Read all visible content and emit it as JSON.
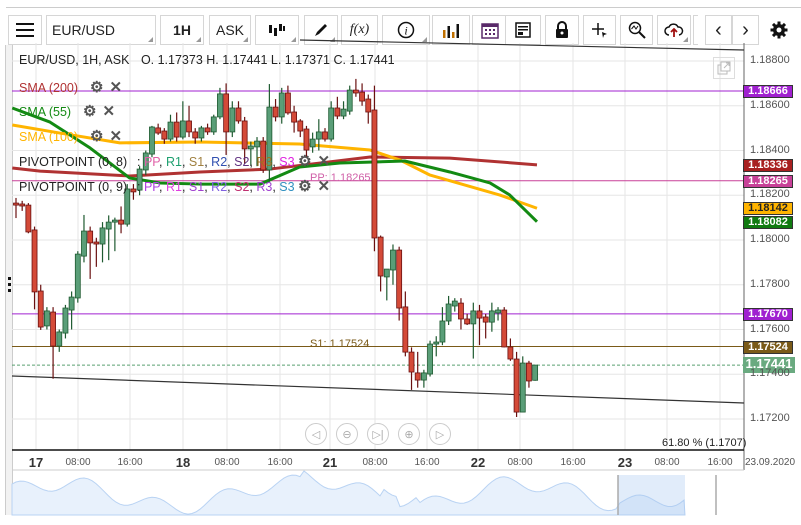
{
  "toolbar": {
    "symbol": "EUR/USD",
    "timeframe": "1H",
    "price_side": "ASK",
    "fx_label": "f(x)",
    "icons": [
      "menu-icon",
      "candlestick-type-icon",
      "pencil-icon",
      "function-icon",
      "info-icon",
      "bar-chart-icon",
      "calendar-icon",
      "news-icon",
      "lock-icon",
      "crosshair-icon",
      "zoom-icon",
      "cloud-upload-icon",
      "chevron-left-icon",
      "chevron-right-icon",
      "gear-icon"
    ]
  },
  "legend": {
    "instrument": "EUR/USD, 1H, ASK",
    "ohlc": "O. 1.17373 H. 1.17441 L. 1.17371 C. 1.17441",
    "indicators": [
      {
        "label": "SMA (200)",
        "color": "#b03232"
      },
      {
        "label": "SMA (55)",
        "color": "#138a13"
      },
      {
        "label": "SMA (100)",
        "color": "#ffb400"
      }
    ],
    "pivots": [
      {
        "label": "PIVOTPOINT (0, 8)",
        "sep": ":",
        "items": [
          {
            "t": "PP",
            "c": "#e060a8"
          },
          {
            "t": "R1",
            "c": "#1fa070"
          },
          {
            "t": "S1",
            "c": "#a08040"
          },
          {
            "t": "R2",
            "c": "#3050b0"
          },
          {
            "t": "S2",
            "c": "#603080"
          },
          {
            "t": "R3",
            "c": "#a07020"
          },
          {
            "t": "S3",
            "c": "#e020e0"
          }
        ]
      },
      {
        "label": "PIVOTPOINT (0, 9)",
        "sep": ":",
        "items": [
          {
            "t": "PP",
            "c": "#b040e0"
          },
          {
            "t": "R1",
            "c": "#e040e0"
          },
          {
            "t": "S1",
            "c": "#a040d0"
          },
          {
            "t": "R2",
            "c": "#8060e0"
          },
          {
            "t": "S2",
            "c": "#c03070"
          },
          {
            "t": "R3",
            "c": "#a040d0"
          },
          {
            "t": "S3",
            "c": "#3090c0"
          }
        ]
      }
    ]
  },
  "annotations": {
    "pp": "PP: 1.18265",
    "s1": "S1: 1.17524",
    "fib": "61.80 % (1.1707)"
  },
  "chart_data": {
    "type": "candlestick",
    "ylim": [
      1.1705,
      1.189
    ],
    "y_ticks": [
      "1.18800",
      "1.18600",
      "1.18400",
      "1.18200",
      "1.18000",
      "1.17800",
      "1.17600",
      "1.17400",
      "1.17200"
    ],
    "x_ticks": [
      {
        "t": "17",
        "day": true
      },
      {
        "t": "08:00"
      },
      {
        "t": "16:00"
      },
      {
        "t": "18",
        "day": true
      },
      {
        "t": "08:00"
      },
      {
        "t": "16:00"
      },
      {
        "t": "21",
        "day": true
      },
      {
        "t": "08:00"
      },
      {
        "t": "16:00"
      },
      {
        "t": "22",
        "day": true
      },
      {
        "t": "08:00"
      },
      {
        "t": "16:00"
      },
      {
        "t": "23",
        "day": true
      },
      {
        "t": "08:00"
      },
      {
        "t": "16:00"
      },
      {
        "t": "23.09.2020"
      }
    ],
    "candles": [
      [
        1.18165,
        1.18188,
        1.18098,
        1.18156
      ],
      [
        1.18161,
        1.18175,
        1.1813,
        1.18152
      ],
      [
        1.18156,
        1.18165,
        1.1803,
        1.18036
      ],
      [
        1.18045,
        1.1806,
        1.1769,
        1.17768
      ],
      [
        1.17772,
        1.178,
        1.17598,
        1.17611
      ],
      [
        1.17616,
        1.177,
        1.176,
        1.17683
      ],
      [
        1.17678,
        1.177,
        1.1738,
        1.17526
      ],
      [
        1.17526,
        1.176,
        1.175,
        1.17589
      ],
      [
        1.17584,
        1.1771,
        1.1756,
        1.17696
      ],
      [
        1.17687,
        1.1777,
        1.176,
        1.17745
      ],
      [
        1.17741,
        1.1795,
        1.1772,
        1.17937
      ],
      [
        1.17928,
        1.18112,
        1.179,
        1.1804
      ],
      [
        1.1804,
        1.1806,
        1.17826,
        1.17987
      ],
      [
        1.17991,
        1.1801,
        1.1788,
        1.17982
      ],
      [
        1.17982,
        1.1808,
        1.179,
        1.18054
      ],
      [
        1.18049,
        1.1811,
        1.1791,
        1.1808
      ],
      [
        1.1808,
        1.181,
        1.1795,
        1.18089
      ],
      [
        1.18089,
        1.1815,
        1.1803,
        1.18071
      ],
      [
        1.18071,
        1.1825,
        1.1806,
        1.18228
      ],
      [
        1.18228,
        1.1825,
        1.1818,
        1.18215
      ],
      [
        1.18223,
        1.1833,
        1.182,
        1.18317
      ],
      [
        1.18313,
        1.184,
        1.1829,
        1.18389
      ],
      [
        1.18384,
        1.1851,
        1.1837,
        1.18505
      ],
      [
        1.18501,
        1.1852,
        1.1847,
        1.18478
      ],
      [
        1.18487,
        1.185,
        1.1843,
        1.18451
      ],
      [
        1.18451,
        1.1856,
        1.1844,
        1.18527
      ],
      [
        1.18527,
        1.1857,
        1.1844,
        1.1846
      ],
      [
        1.1846,
        1.1862,
        1.1845,
        1.18532
      ],
      [
        1.18532,
        1.186,
        1.1846,
        1.18483
      ],
      [
        1.18483,
        1.185,
        1.1843,
        1.18456
      ],
      [
        1.18456,
        1.1851,
        1.1844,
        1.18501
      ],
      [
        1.18501,
        1.1852,
        1.1847,
        1.18483
      ],
      [
        1.18483,
        1.1856,
        1.1847,
        1.1855
      ],
      [
        1.1855,
        1.1868,
        1.1854,
        1.18653
      ],
      [
        1.18653,
        1.187,
        1.1838,
        1.18483
      ],
      [
        1.18483,
        1.1862,
        1.1846,
        1.1859
      ],
      [
        1.1859,
        1.1862,
        1.1852,
        1.18532
      ],
      [
        1.18532,
        1.1855,
        1.1834,
        1.18407
      ],
      [
        1.18407,
        1.1844,
        1.1833,
        1.1842
      ],
      [
        1.18416,
        1.1846,
        1.1833,
        1.18442
      ],
      [
        1.18442,
        1.1846,
        1.183,
        1.18313
      ],
      [
        1.18313,
        1.18697,
        1.1826,
        1.18594
      ],
      [
        1.18594,
        1.1863,
        1.1853,
        1.1855
      ],
      [
        1.1855,
        1.1868,
        1.1852,
        1.18657
      ],
      [
        1.18657,
        1.1869,
        1.1856,
        1.18568
      ],
      [
        1.18572,
        1.186,
        1.1848,
        1.18527
      ],
      [
        1.18532,
        1.1854,
        1.1846,
        1.18487
      ],
      [
        1.18496,
        1.1851,
        1.1837,
        1.18402
      ],
      [
        1.18416,
        1.1848,
        1.1839,
        1.18451
      ],
      [
        1.18451,
        1.1854,
        1.184,
        1.18483
      ],
      [
        1.18483,
        1.185,
        1.1844,
        1.18451
      ],
      [
        1.18451,
        1.1862,
        1.1844,
        1.1859
      ],
      [
        1.1859,
        1.1864,
        1.1854,
        1.18554
      ],
      [
        1.18554,
        1.1862,
        1.1854,
        1.18585
      ],
      [
        1.18576,
        1.1869,
        1.1856,
        1.1867
      ],
      [
        1.1867,
        1.1872,
        1.1864,
        1.18657
      ],
      [
        1.18661,
        1.187,
        1.186,
        1.18621
      ],
      [
        1.1863,
        1.1865,
        1.1852,
        1.18572
      ],
      [
        1.18581,
        1.1869,
        1.1795,
        1.18009
      ],
      [
        1.18013,
        1.1802,
        1.1777,
        1.17839
      ],
      [
        1.17835,
        1.1785,
        1.1773,
        1.1787
      ],
      [
        1.17866,
        1.1798,
        1.178,
        1.17955
      ],
      [
        1.17955,
        1.1797,
        1.1764,
        1.17696
      ],
      [
        1.17701,
        1.1777,
        1.1748,
        1.17499
      ],
      [
        1.17499,
        1.1752,
        1.1733,
        1.1741
      ],
      [
        1.17406,
        1.175,
        1.1734,
        1.17374
      ],
      [
        1.17374,
        1.1742,
        1.1734,
        1.17406
      ],
      [
        1.17401,
        1.1755,
        1.1739,
        1.17535
      ],
      [
        1.17535,
        1.1757,
        1.1748,
        1.17544
      ],
      [
        1.17544,
        1.177,
        1.1753,
        1.17638
      ],
      [
        1.17638,
        1.1775,
        1.1762,
        1.17714
      ],
      [
        1.17705,
        1.1774,
        1.1768,
        1.17727
      ],
      [
        1.17718,
        1.1774,
        1.176,
        1.17647
      ],
      [
        1.17647,
        1.1767,
        1.1762,
        1.17625
      ],
      [
        1.17625,
        1.1772,
        1.1747,
        1.17683
      ],
      [
        1.17683,
        1.1771,
        1.1753,
        1.17651
      ],
      [
        1.17656,
        1.1767,
        1.1756,
        1.17633
      ],
      [
        1.17633,
        1.1772,
        1.1759,
        1.17683
      ],
      [
        1.17674,
        1.177,
        1.1764,
        1.17687
      ],
      [
        1.17687,
        1.177,
        1.1752,
        1.17522
      ],
      [
        1.17522,
        1.1756,
        1.1746,
        1.17468
      ],
      [
        1.17468,
        1.175,
        1.17209,
        1.17231
      ],
      [
        1.17231,
        1.1748,
        1.17231,
        1.1745
      ],
      [
        1.1745,
        1.1746,
        1.1734,
        1.1737
      ],
      [
        1.17373,
        1.17441,
        1.17371,
        1.17441
      ]
    ],
    "sma": [
      {
        "name": "SMA (200)",
        "color": "#b03232",
        "points": [
          [
            -0.6,
            1.18322
          ],
          [
            3.9,
            1.18308
          ],
          [
            18.4,
            1.18286
          ],
          [
            29.8,
            1.18304
          ],
          [
            41.1,
            1.18317
          ],
          [
            57.3,
            1.18371
          ],
          [
            70.2,
            1.18366
          ],
          [
            84.3,
            1.18336
          ]
        ]
      },
      {
        "name": "SMA (100)",
        "color": "#ffb400",
        "points": [
          [
            -0.6,
            1.18514
          ],
          [
            7.1,
            1.18478
          ],
          [
            16.8,
            1.18434
          ],
          [
            29.8,
            1.18438
          ],
          [
            45.9,
            1.18429
          ],
          [
            57.3,
            1.18402
          ],
          [
            62.1,
            1.18358
          ],
          [
            67,
            1.1829
          ],
          [
            78.3,
            1.18201
          ],
          [
            84.3,
            1.18142
          ]
        ]
      },
      {
        "name": "SMA (55)",
        "color": "#138a13",
        "points": [
          [
            -0.6,
            1.1859
          ],
          [
            5.5,
            1.18527
          ],
          [
            12,
            1.18411
          ],
          [
            18.4,
            1.18277
          ],
          [
            23.3,
            1.18255
          ],
          [
            29.8,
            1.1825
          ],
          [
            39.5,
            1.1825
          ],
          [
            45.9,
            1.18326
          ],
          [
            52.4,
            1.18344
          ],
          [
            62.9,
            1.18353
          ],
          [
            70.2,
            1.18304
          ],
          [
            76.7,
            1.18255
          ],
          [
            79.9,
            1.18201
          ],
          [
            84.3,
            1.18082
          ]
        ]
      }
    ],
    "hlines": [
      {
        "price": 1.18666,
        "label": "1.18666",
        "color": "#a020d0",
        "badge": "#a020d0"
      },
      {
        "price": 1.18265,
        "label": "1.18265",
        "color": "#c84098",
        "badge": "#c84098"
      },
      {
        "price": 1.1767,
        "label": "1.17670",
        "color": "#a020d0",
        "badge": "#a020d0"
      },
      {
        "price": 1.17524,
        "label": "1.17524",
        "color": "#7a5a18",
        "badge": "#7a5a18"
      },
      {
        "price": 1.17441,
        "label": "1.17441",
        "color": "#5aa070",
        "badge": "#6aaa80",
        "dashed": true
      }
    ],
    "sma_badges": [
      {
        "label": "1.18336",
        "color": "#a82020"
      },
      {
        "label": "1.18142",
        "color": "#ffb400",
        "text": "#222"
      },
      {
        "label": "1.18082",
        "color": "#107a10"
      }
    ],
    "colors": {
      "up": "#5a9e78",
      "down": "#d44a38"
    }
  },
  "nav_buttons": [
    "scroll-left",
    "zoom-out",
    "go-to-end",
    "zoom-in",
    "scroll-right"
  ]
}
